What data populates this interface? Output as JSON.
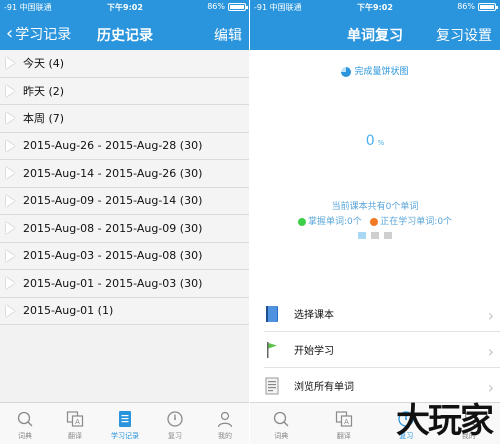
{
  "status": {
    "carrier": "-91 中国联通",
    "time": "下午9:02",
    "battery": "86%",
    "battery_level": 0.86
  },
  "left": {
    "nav": {
      "back_label": "学习记录",
      "title": "历史记录",
      "edit_label": "编辑"
    },
    "rows": [
      "今天 (4)",
      "昨天 (2)",
      "本周 (7)",
      "2015-Aug-26 - 2015-Aug-28 (30)",
      "2015-Aug-14 - 2015-Aug-26 (30)",
      "2015-Aug-09 - 2015-Aug-14 (30)",
      "2015-Aug-08 - 2015-Aug-09 (30)",
      "2015-Aug-03 - 2015-Aug-08 (30)",
      "2015-Aug-01 - 2015-Aug-03 (30)",
      "2015-Aug-01 (1)"
    ],
    "tabs": [
      {
        "label": "词典",
        "icon": "search-icon"
      },
      {
        "label": "翻译",
        "icon": "translate-icon"
      },
      {
        "label": "学习记录",
        "icon": "document-icon",
        "active": true
      },
      {
        "label": "复习",
        "icon": "clock-icon"
      },
      {
        "label": "我的",
        "icon": "person-icon"
      }
    ]
  },
  "right": {
    "nav": {
      "title": "单词复习",
      "settings_label": "复习设置"
    },
    "chart_title": "完成量饼状图",
    "percent_value": "0",
    "percent_unit": "%",
    "summary": "当前课本共有0个单词",
    "legend": {
      "mastered": "掌握单词:0个",
      "learning": "正在学习单词:0个",
      "mastered_color": "#3ecf4a",
      "learning_color": "#f07a26"
    },
    "menu": [
      {
        "label": "选择课本",
        "icon": "book-icon"
      },
      {
        "label": "开始学习",
        "icon": "flag-icon"
      },
      {
        "label": "浏览所有单词",
        "icon": "list-icon"
      }
    ],
    "arrow": "›",
    "tabs": [
      {
        "label": "词典",
        "icon": "search-icon"
      },
      {
        "label": "翻译",
        "icon": "translate-icon"
      },
      {
        "label": "复习",
        "icon": "clock-icon",
        "active": true
      },
      {
        "label": "我的",
        "icon": "person-icon"
      }
    ]
  },
  "watermark": "大玩家",
  "colors": {
    "accent": "#2a95dd",
    "tab_inactive": "#8a8a8a"
  }
}
